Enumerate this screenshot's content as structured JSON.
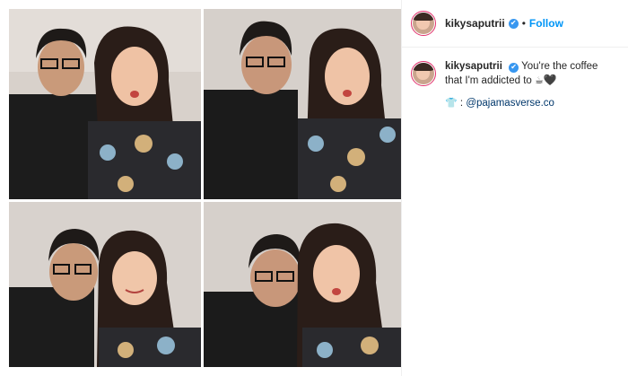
{
  "header": {
    "username": "kikysaputrii",
    "dot": "•",
    "follow_label": "Follow",
    "verified_icon": "✔"
  },
  "caption": {
    "username": "kikysaputrii",
    "text": "You're the coffee that I'm addicted to",
    "cup_icon": "☕",
    "heart_icon": "🖤",
    "shirt_icon": "👕",
    "mention_prefix": ":",
    "mention": "@pajamasverse.co"
  },
  "colors": {
    "accent": "#0095f6",
    "verified": "#3897f0",
    "avatar_ring": "#e1306c"
  }
}
